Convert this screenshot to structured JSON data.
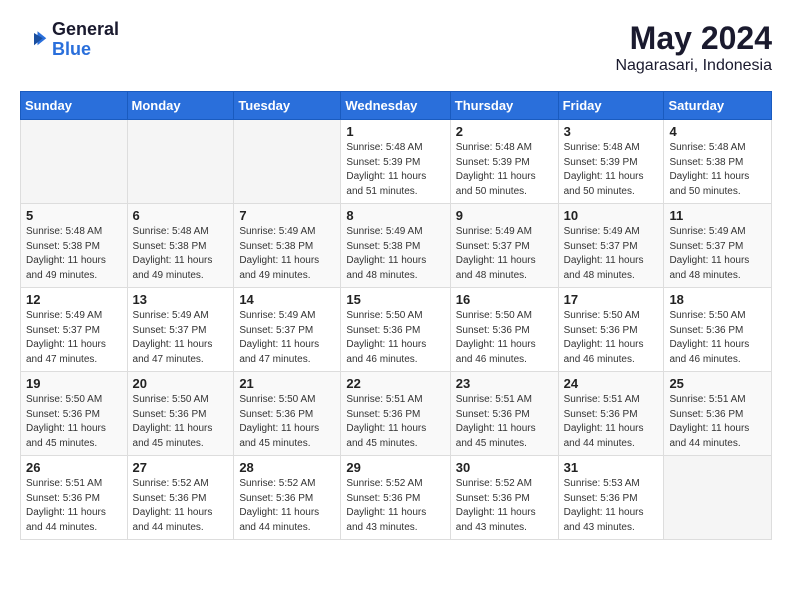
{
  "logo": {
    "line1": "General",
    "line2": "Blue"
  },
  "title": "May 2024",
  "subtitle": "Nagarasari, Indonesia",
  "days_header": [
    "Sunday",
    "Monday",
    "Tuesday",
    "Wednesday",
    "Thursday",
    "Friday",
    "Saturday"
  ],
  "weeks": [
    [
      {
        "num": "",
        "info": ""
      },
      {
        "num": "",
        "info": ""
      },
      {
        "num": "",
        "info": ""
      },
      {
        "num": "1",
        "info": "Sunrise: 5:48 AM\nSunset: 5:39 PM\nDaylight: 11 hours\nand 51 minutes."
      },
      {
        "num": "2",
        "info": "Sunrise: 5:48 AM\nSunset: 5:39 PM\nDaylight: 11 hours\nand 50 minutes."
      },
      {
        "num": "3",
        "info": "Sunrise: 5:48 AM\nSunset: 5:39 PM\nDaylight: 11 hours\nand 50 minutes."
      },
      {
        "num": "4",
        "info": "Sunrise: 5:48 AM\nSunset: 5:38 PM\nDaylight: 11 hours\nand 50 minutes."
      }
    ],
    [
      {
        "num": "5",
        "info": "Sunrise: 5:48 AM\nSunset: 5:38 PM\nDaylight: 11 hours\nand 49 minutes."
      },
      {
        "num": "6",
        "info": "Sunrise: 5:48 AM\nSunset: 5:38 PM\nDaylight: 11 hours\nand 49 minutes."
      },
      {
        "num": "7",
        "info": "Sunrise: 5:49 AM\nSunset: 5:38 PM\nDaylight: 11 hours\nand 49 minutes."
      },
      {
        "num": "8",
        "info": "Sunrise: 5:49 AM\nSunset: 5:38 PM\nDaylight: 11 hours\nand 48 minutes."
      },
      {
        "num": "9",
        "info": "Sunrise: 5:49 AM\nSunset: 5:37 PM\nDaylight: 11 hours\nand 48 minutes."
      },
      {
        "num": "10",
        "info": "Sunrise: 5:49 AM\nSunset: 5:37 PM\nDaylight: 11 hours\nand 48 minutes."
      },
      {
        "num": "11",
        "info": "Sunrise: 5:49 AM\nSunset: 5:37 PM\nDaylight: 11 hours\nand 48 minutes."
      }
    ],
    [
      {
        "num": "12",
        "info": "Sunrise: 5:49 AM\nSunset: 5:37 PM\nDaylight: 11 hours\nand 47 minutes."
      },
      {
        "num": "13",
        "info": "Sunrise: 5:49 AM\nSunset: 5:37 PM\nDaylight: 11 hours\nand 47 minutes."
      },
      {
        "num": "14",
        "info": "Sunrise: 5:49 AM\nSunset: 5:37 PM\nDaylight: 11 hours\nand 47 minutes."
      },
      {
        "num": "15",
        "info": "Sunrise: 5:50 AM\nSunset: 5:36 PM\nDaylight: 11 hours\nand 46 minutes."
      },
      {
        "num": "16",
        "info": "Sunrise: 5:50 AM\nSunset: 5:36 PM\nDaylight: 11 hours\nand 46 minutes."
      },
      {
        "num": "17",
        "info": "Sunrise: 5:50 AM\nSunset: 5:36 PM\nDaylight: 11 hours\nand 46 minutes."
      },
      {
        "num": "18",
        "info": "Sunrise: 5:50 AM\nSunset: 5:36 PM\nDaylight: 11 hours\nand 46 minutes."
      }
    ],
    [
      {
        "num": "19",
        "info": "Sunrise: 5:50 AM\nSunset: 5:36 PM\nDaylight: 11 hours\nand 45 minutes."
      },
      {
        "num": "20",
        "info": "Sunrise: 5:50 AM\nSunset: 5:36 PM\nDaylight: 11 hours\nand 45 minutes."
      },
      {
        "num": "21",
        "info": "Sunrise: 5:50 AM\nSunset: 5:36 PM\nDaylight: 11 hours\nand 45 minutes."
      },
      {
        "num": "22",
        "info": "Sunrise: 5:51 AM\nSunset: 5:36 PM\nDaylight: 11 hours\nand 45 minutes."
      },
      {
        "num": "23",
        "info": "Sunrise: 5:51 AM\nSunset: 5:36 PM\nDaylight: 11 hours\nand 45 minutes."
      },
      {
        "num": "24",
        "info": "Sunrise: 5:51 AM\nSunset: 5:36 PM\nDaylight: 11 hours\nand 44 minutes."
      },
      {
        "num": "25",
        "info": "Sunrise: 5:51 AM\nSunset: 5:36 PM\nDaylight: 11 hours\nand 44 minutes."
      }
    ],
    [
      {
        "num": "26",
        "info": "Sunrise: 5:51 AM\nSunset: 5:36 PM\nDaylight: 11 hours\nand 44 minutes."
      },
      {
        "num": "27",
        "info": "Sunrise: 5:52 AM\nSunset: 5:36 PM\nDaylight: 11 hours\nand 44 minutes."
      },
      {
        "num": "28",
        "info": "Sunrise: 5:52 AM\nSunset: 5:36 PM\nDaylight: 11 hours\nand 44 minutes."
      },
      {
        "num": "29",
        "info": "Sunrise: 5:52 AM\nSunset: 5:36 PM\nDaylight: 11 hours\nand 43 minutes."
      },
      {
        "num": "30",
        "info": "Sunrise: 5:52 AM\nSunset: 5:36 PM\nDaylight: 11 hours\nand 43 minutes."
      },
      {
        "num": "31",
        "info": "Sunrise: 5:53 AM\nSunset: 5:36 PM\nDaylight: 11 hours\nand 43 minutes."
      },
      {
        "num": "",
        "info": ""
      }
    ]
  ]
}
